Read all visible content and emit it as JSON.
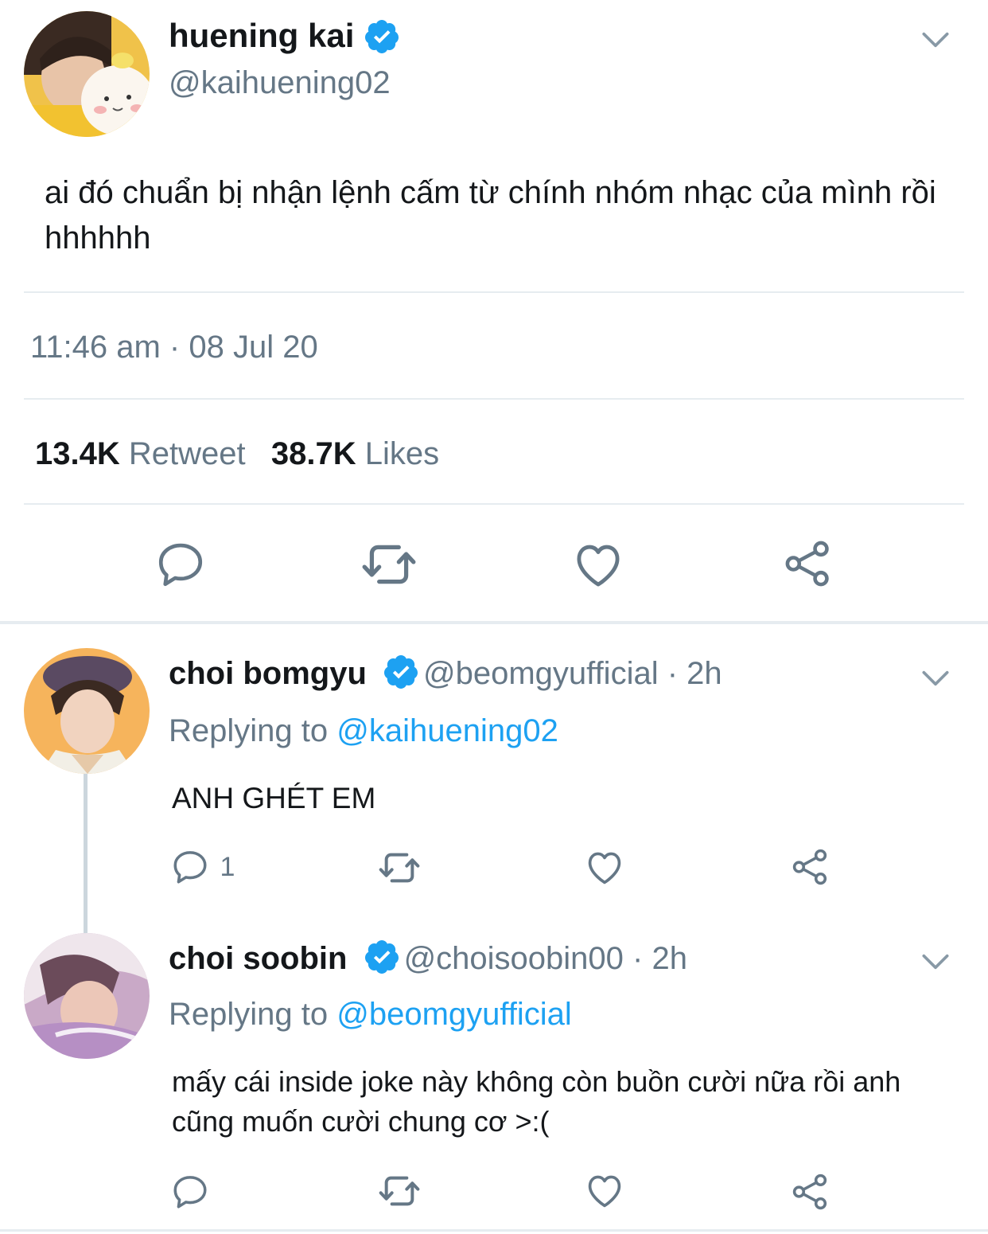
{
  "main_tweet": {
    "name": "huening kai",
    "handle": "@kaihuening02",
    "text": "ai đó chuẩn bị nhận lệnh cấm từ chính nhóm nhạc của mình rồi hhhhhh",
    "timestamp": "11:46 am · 08 Jul 20",
    "retweet_count": "13.4K",
    "retweet_label": "Retweet",
    "like_count": "38.7K",
    "like_label": "Likes"
  },
  "replies": [
    {
      "name": "choi bomgyu",
      "handle": "@beomgyufficial",
      "time": "· 2h",
      "replying_prefix": "Replying to",
      "replying_to": "@kaihuening02",
      "text": "ANH GHÉT EM",
      "reply_count": "1"
    },
    {
      "name": "choi soobin",
      "handle": "@choisoobin00",
      "time": "· 2h",
      "replying_prefix": "Replying to",
      "replying_to": "@beomgyufficial",
      "text": "mấy cái inside joke này không còn buồn cười nữa rồi anh cũng muốn cười chung cơ >:("
    }
  ],
  "icons": [
    "reply-icon",
    "retweet-icon",
    "like-icon",
    "share-icon",
    "verified-badge-icon",
    "chevron-down-icon"
  ],
  "colors": {
    "accent": "#1da1f2",
    "muted": "#657786",
    "divider": "#e6ecf0",
    "icon": "#657786"
  }
}
